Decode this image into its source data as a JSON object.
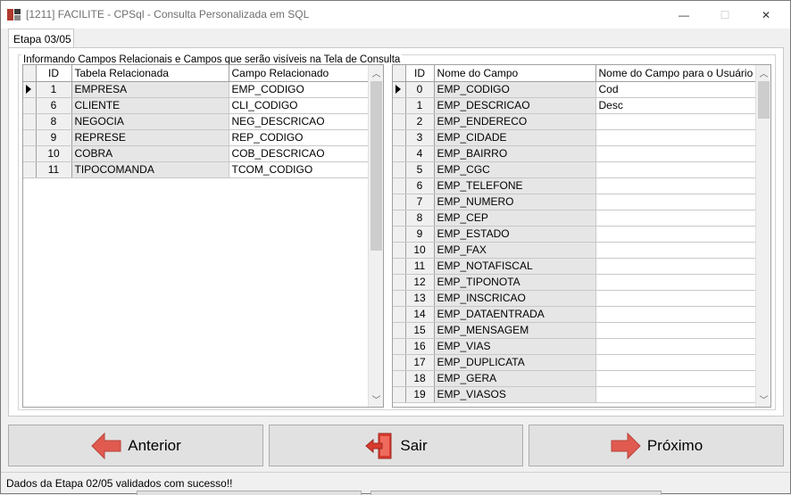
{
  "window": {
    "title": "[1211] FACILITE - CPSql - Consulta Personalizada em SQL",
    "minimize": "—",
    "maximize": "☐",
    "close": "✕"
  },
  "tab": {
    "label": "Etapa 03/05"
  },
  "group": {
    "label": "Informando Campos Relacionais e Campos que serão visíveis na Tela de Consulta"
  },
  "left_grid": {
    "headers": {
      "id": "ID",
      "table": "Tabela Relacionada",
      "field": "Campo Relacionado"
    },
    "rows": [
      {
        "id": "1",
        "table": "EMPRESA",
        "field": "EMP_CODIGO"
      },
      {
        "id": "6",
        "table": "CLIENTE",
        "field": "CLI_CODIGO"
      },
      {
        "id": "8",
        "table": "NEGOCIA",
        "field": "NEG_DESCRICAO"
      },
      {
        "id": "9",
        "table": "REPRESE",
        "field": "REP_CODIGO"
      },
      {
        "id": "10",
        "table": "COBRA",
        "field": "COB_DESCRICAO"
      },
      {
        "id": "11",
        "table": "TIPOCOMANDA",
        "field": "TCOM_CODIGO"
      }
    ]
  },
  "right_grid": {
    "headers": {
      "id": "ID",
      "name": "Nome do Campo",
      "user": "Nome do Campo para o Usuário"
    },
    "rows": [
      {
        "id": "0",
        "name": "EMP_CODIGO",
        "user": "Cod"
      },
      {
        "id": "1",
        "name": "EMP_DESCRICAO",
        "user": "Desc"
      },
      {
        "id": "2",
        "name": "EMP_ENDERECO",
        "user": ""
      },
      {
        "id": "3",
        "name": "EMP_CIDADE",
        "user": ""
      },
      {
        "id": "4",
        "name": "EMP_BAIRRO",
        "user": ""
      },
      {
        "id": "5",
        "name": "EMP_CGC",
        "user": ""
      },
      {
        "id": "6",
        "name": "EMP_TELEFONE",
        "user": ""
      },
      {
        "id": "7",
        "name": "EMP_NUMERO",
        "user": ""
      },
      {
        "id": "8",
        "name": "EMP_CEP",
        "user": ""
      },
      {
        "id": "9",
        "name": "EMP_ESTADO",
        "user": ""
      },
      {
        "id": "10",
        "name": "EMP_FAX",
        "user": ""
      },
      {
        "id": "11",
        "name": "EMP_NOTAFISCAL",
        "user": ""
      },
      {
        "id": "12",
        "name": "EMP_TIPONOTA",
        "user": ""
      },
      {
        "id": "13",
        "name": "EMP_INSCRICAO",
        "user": ""
      },
      {
        "id": "14",
        "name": "EMP_DATAENTRADA",
        "user": ""
      },
      {
        "id": "15",
        "name": "EMP_MENSAGEM",
        "user": ""
      },
      {
        "id": "16",
        "name": "EMP_VIAS",
        "user": ""
      },
      {
        "id": "17",
        "name": "EMP_DUPLICATA",
        "user": ""
      },
      {
        "id": "18",
        "name": "EMP_GERA",
        "user": ""
      },
      {
        "id": "19",
        "name": "EMP_VIASOS",
        "user": ""
      }
    ]
  },
  "buttons": {
    "previous": "Anterior",
    "exit": "Sair",
    "next": "Próximo"
  },
  "status": {
    "text": "Dados da Etapa 02/05 validados com sucesso!!"
  },
  "colors": {
    "arrow_red": "#e05a4f",
    "door_red": "#d83a2e"
  }
}
